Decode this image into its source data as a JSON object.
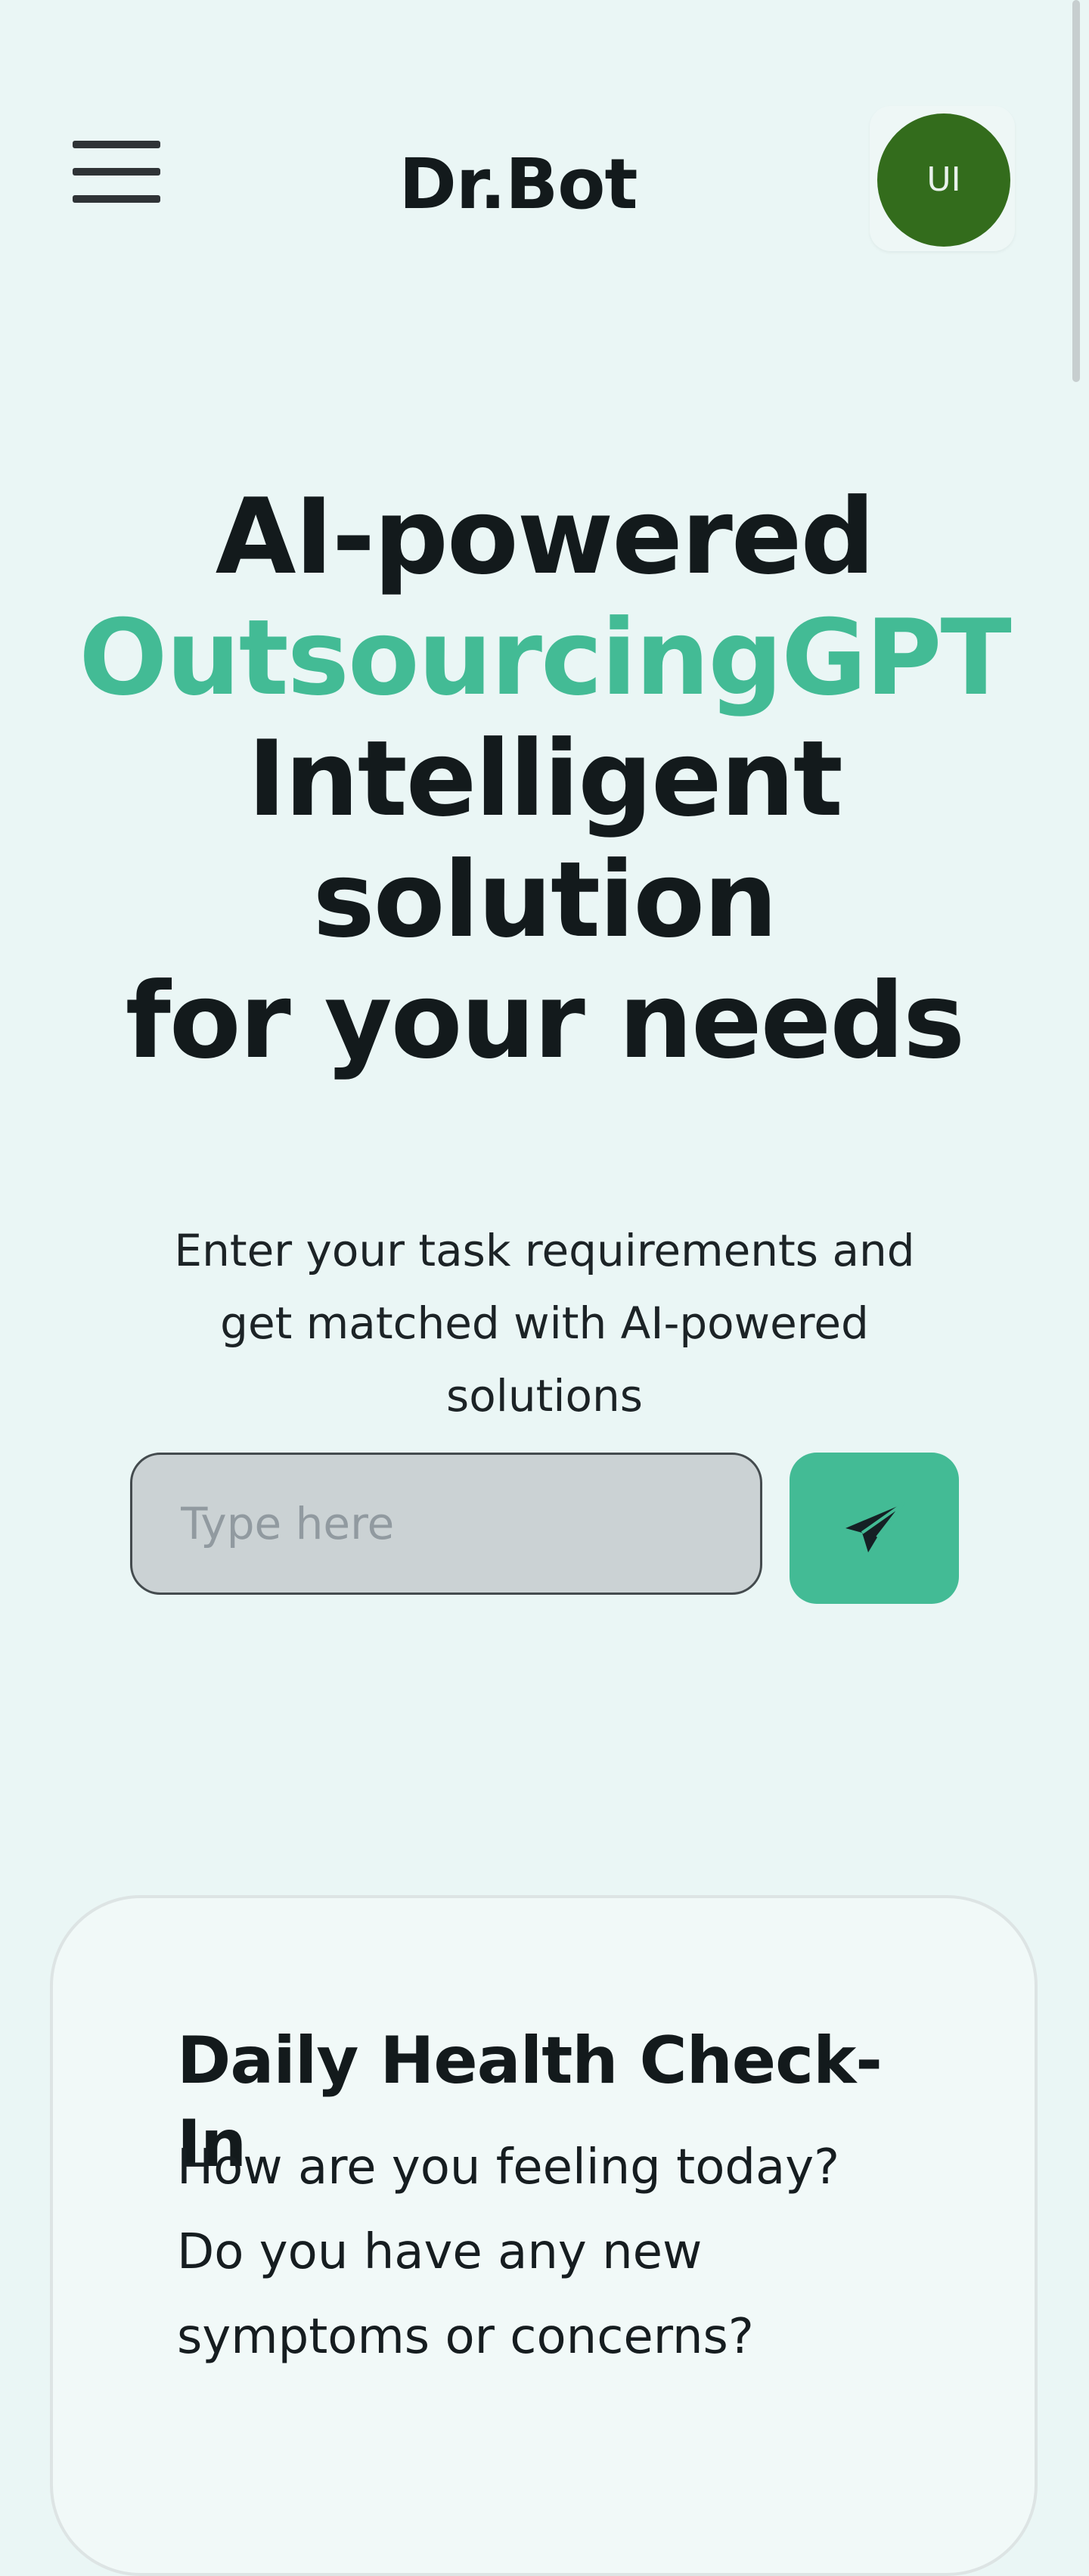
{
  "header": {
    "brand": "Dr.Bot",
    "avatar_initials": "UI",
    "menu_icon": "hamburger-menu-icon"
  },
  "hero": {
    "line1": "AI-powered",
    "line2": "OutsourcingGPT",
    "line3": "Intelligent solution",
    "line4": "for your needs",
    "accent_color": "#43bb95"
  },
  "prompt": {
    "text": "Enter your task requirements and get matched with AI-powered solutions",
    "placeholder": "Type here",
    "value": "",
    "send_icon": "paper-plane-send-icon"
  },
  "card": {
    "title": "Daily Health Check-In",
    "body": "How are you feeling today? Do you have any new symptoms or concerns?"
  },
  "colors": {
    "background": "#eaf6f5",
    "accent": "#43bb95",
    "avatar": "#336c1c",
    "text": "#131a1c"
  }
}
